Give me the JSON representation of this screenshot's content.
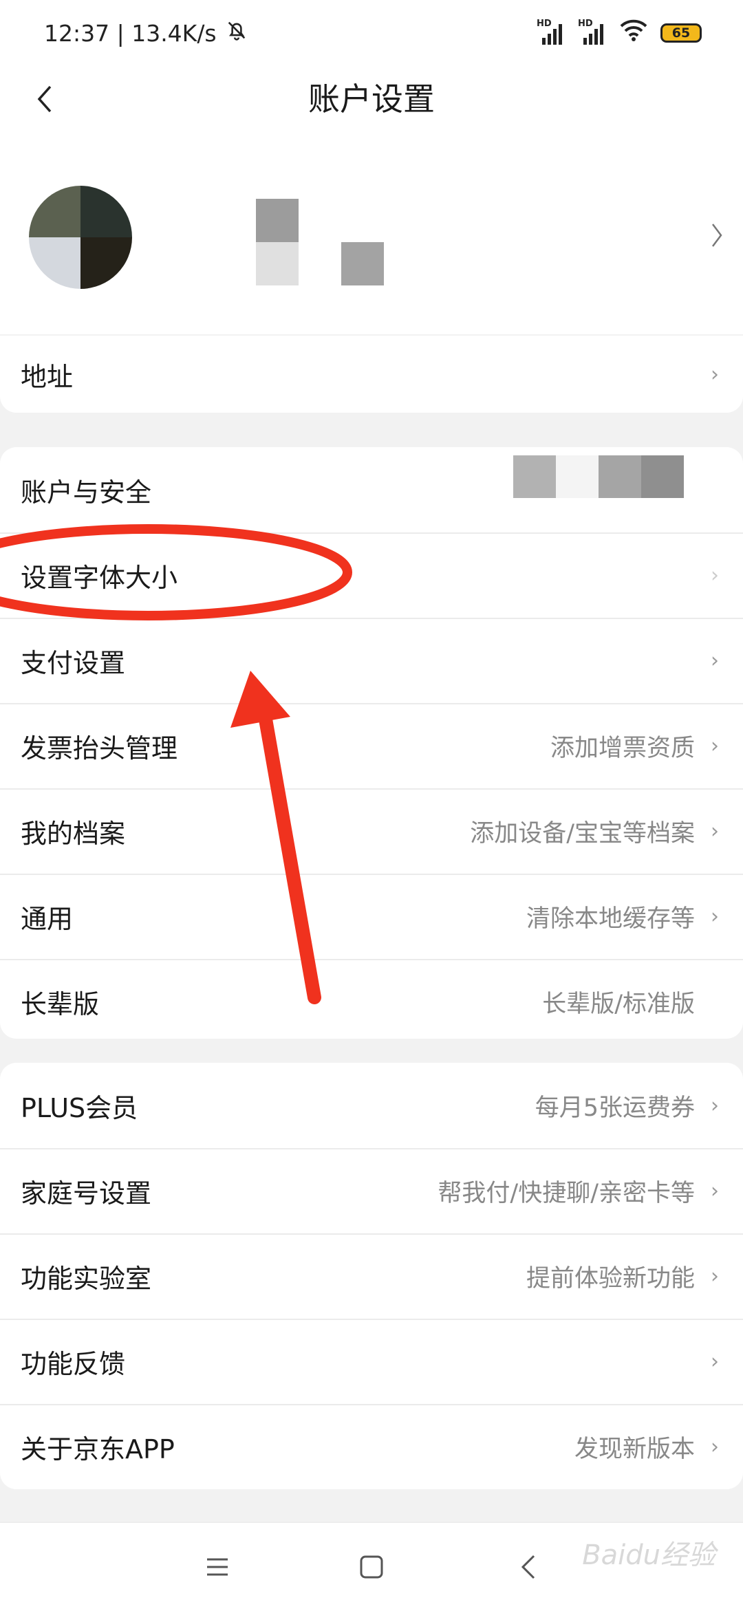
{
  "status_bar": {
    "time_speed": "12:37 | 13.4K/s",
    "signal1_label": "HD",
    "signal2_label": "HD",
    "battery": "65"
  },
  "header": {
    "title": "账户设置"
  },
  "address_row": {
    "label": "地址"
  },
  "settings_group1": [
    {
      "label": "账户与安全",
      "value": ""
    },
    {
      "label": "设置字体大小",
      "value": ""
    },
    {
      "label": "支付设置",
      "value": ""
    },
    {
      "label": "发票抬头管理",
      "value": "添加增票资质"
    },
    {
      "label": "我的档案",
      "value": "添加设备/宝宝等档案"
    },
    {
      "label": "通用",
      "value": "清除本地缓存等"
    },
    {
      "label": "长辈版",
      "value": "长辈版/标准版"
    }
  ],
  "settings_group2": [
    {
      "label": "PLUS会员",
      "value": "每月5张运费券"
    },
    {
      "label": "家庭号设置",
      "value": "帮我付/快捷聊/亲密卡等"
    },
    {
      "label": "功能实验室",
      "value": "提前体验新功能"
    },
    {
      "label": "功能反馈",
      "value": ""
    },
    {
      "label": "关于京东APP",
      "value": "发现新版本"
    }
  ],
  "watermark": "Baidu经验",
  "colors": {
    "annotation_red": "#f0321e",
    "background": "#f2f2f2",
    "value_grey": "#888888"
  }
}
